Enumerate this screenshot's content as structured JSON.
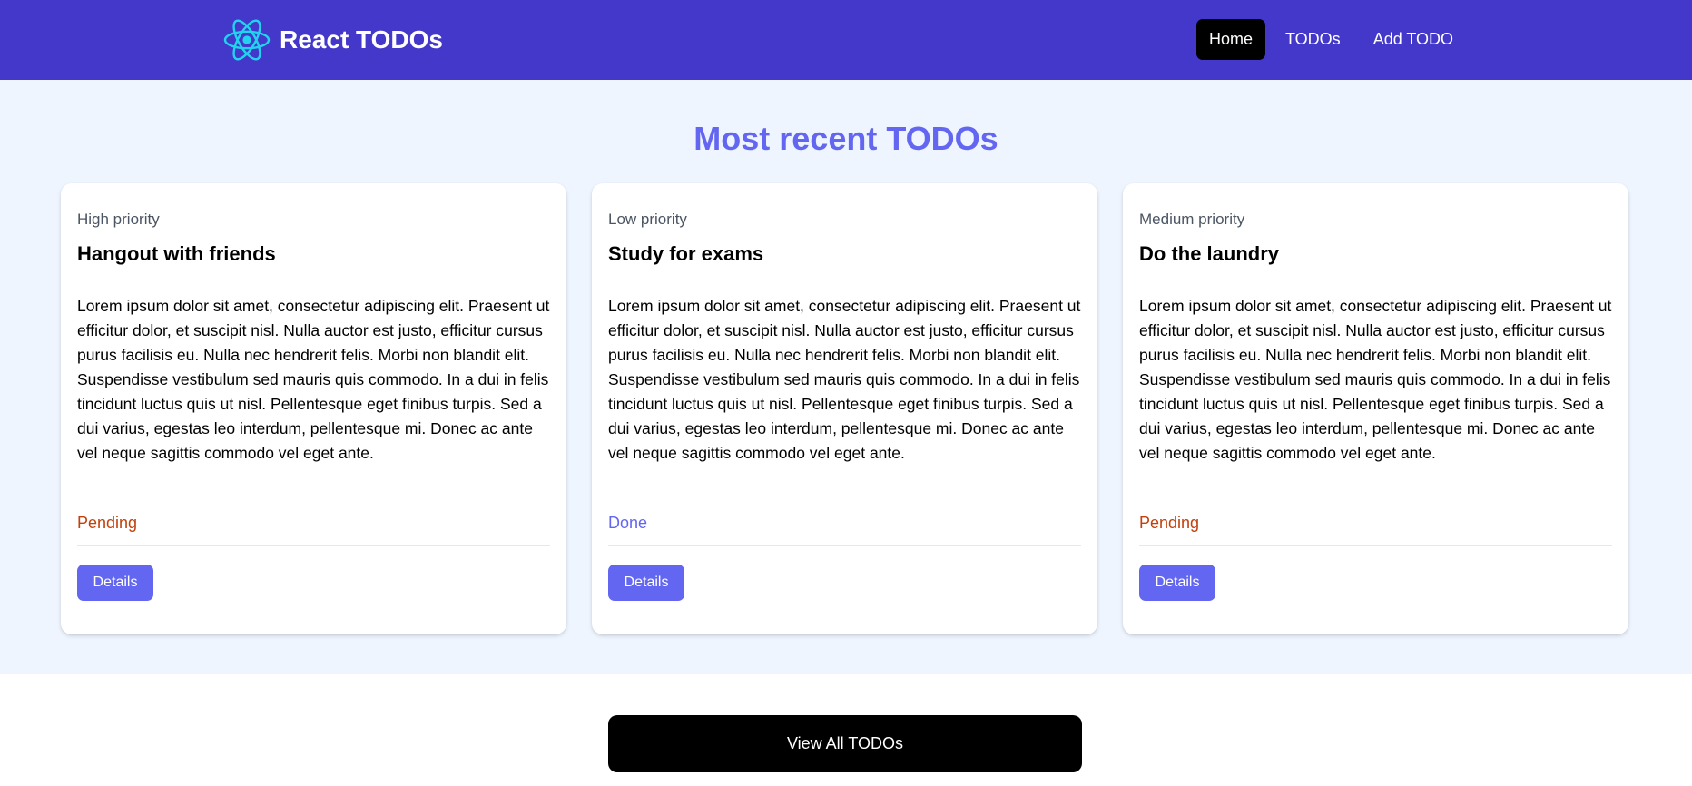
{
  "navbar": {
    "brand_title": "React TODOs",
    "brand_icon": "react-atom-icon",
    "links": [
      {
        "label": "Home",
        "active": true
      },
      {
        "label": "TODOs",
        "active": false
      },
      {
        "label": "Add TODO",
        "active": false
      }
    ]
  },
  "hero": {
    "title": "Most recent TODOs"
  },
  "cards": [
    {
      "priority": "High priority",
      "title": "Hangout with friends",
      "description": "Lorem ipsum dolor sit amet, consectetur adipiscing elit. Praesent ut efficitur dolor, et suscipit nisl. Nulla auctor est justo, efficitur cursus purus facilisis eu. Nulla nec hendrerit felis. Morbi non blandit elit. Suspendisse vestibulum sed mauris quis commodo. In a dui in felis tincidunt luctus quis ut nisl. Pellentesque eget finibus turpis. Sed a dui varius, egestas leo interdum, pellentesque mi. Donec ac ante vel neque sagittis commodo vel eget ante.",
      "status": "Pending",
      "status_color": "#c2410c",
      "button_label": "Details"
    },
    {
      "priority": "Low priority",
      "title": "Study for exams",
      "description": "Lorem ipsum dolor sit amet, consectetur adipiscing elit. Praesent ut efficitur dolor, et suscipit nisl. Nulla auctor est justo, efficitur cursus purus facilisis eu. Nulla nec hendrerit felis. Morbi non blandit elit. Suspendisse vestibulum sed mauris quis commodo. In a dui in felis tincidunt luctus quis ut nisl. Pellentesque eget finibus turpis. Sed a dui varius, egestas leo interdum, pellentesque mi. Donec ac ante vel neque sagittis commodo vel eget ante.",
      "status": "Done",
      "status_color": "#6366f1",
      "button_label": "Details"
    },
    {
      "priority": "Medium priority",
      "title": "Do the laundry",
      "description": "Lorem ipsum dolor sit amet, consectetur adipiscing elit. Praesent ut efficitur dolor, et suscipit nisl. Nulla auctor est justo, efficitur cursus purus facilisis eu. Nulla nec hendrerit felis. Morbi non blandit elit. Suspendisse vestibulum sed mauris quis commodo. In a dui in felis tincidunt luctus quis ut nisl. Pellentesque eget finibus turpis. Sed a dui varius, egestas leo interdum, pellentesque mi. Donec ac ante vel neque sagittis commodo vel eget ante.",
      "status": "Pending",
      "status_color": "#c2410c",
      "button_label": "Details"
    }
  ],
  "footer": {
    "view_all_label": "View All TODOs"
  },
  "colors": {
    "navbar_bg": "#4338ca",
    "hero_bg": "#eef5ff",
    "accent": "#6366f1",
    "react_logo": "#22d3ee"
  }
}
